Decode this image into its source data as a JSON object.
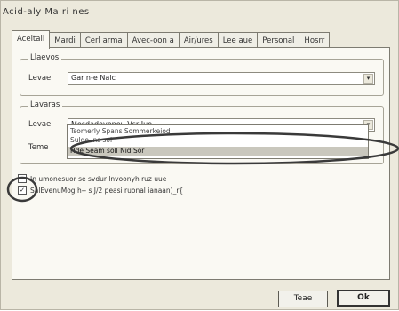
{
  "window": {
    "title": "Acid-aly Ma ri nes"
  },
  "tabs": [
    {
      "label": "Aceitali"
    },
    {
      "label": "Mardi"
    },
    {
      "label": "Cerl arma"
    },
    {
      "label": "Avec-oon a"
    },
    {
      "label": "Air/ures"
    },
    {
      "label": "Lee aue"
    },
    {
      "label": "Personal"
    },
    {
      "label": "Hosrr"
    }
  ],
  "group1": {
    "title": "Llaevos",
    "field_label": "Levae",
    "field_value": "Gar n-e Nalc"
  },
  "group2": {
    "title": "Lavaras",
    "field_label": "Levae",
    "field_value": "Mesdadeveneu Vsr Jue",
    "field2_label": "Teme",
    "dropdown_items": [
      {
        "label": "Tsomerly Spans Sommerkeiod"
      },
      {
        "label": "Sulde ins sol"
      },
      {
        "label": "Hde Seam soll Nid Sor"
      }
    ]
  },
  "checkboxes": [
    {
      "label": "In umonesuor se svdur lnvoonyh ruz uue",
      "checked": false
    },
    {
      "label": "SalEvenuMog h-- s J/2 peasi ruonal ianaan)_r{",
      "checked": true
    }
  ],
  "buttons": {
    "cancel": "Teae",
    "ok": "Ok"
  },
  "colors": {
    "dialog_bg": "#ece9dc",
    "panel_bg": "#faf9f3",
    "annotation_stroke": "#3a3a3a"
  }
}
